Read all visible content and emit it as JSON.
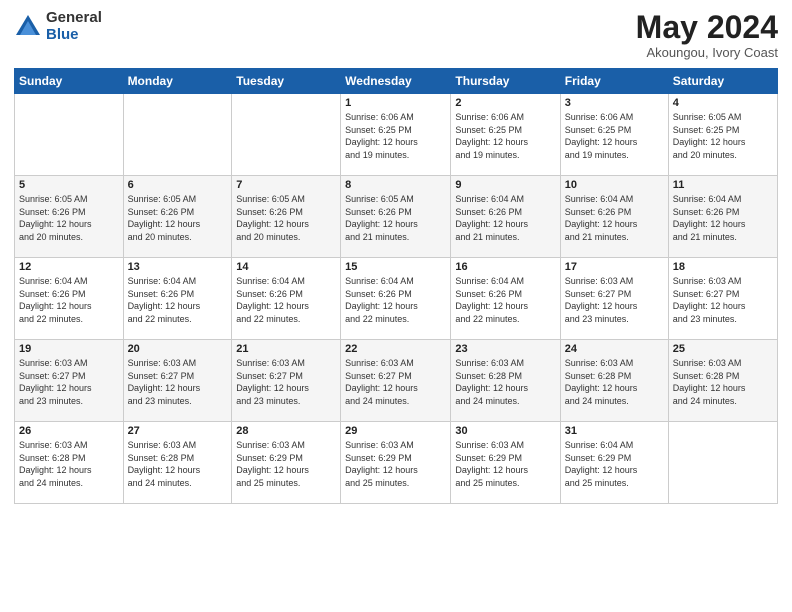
{
  "header": {
    "logo_general": "General",
    "logo_blue": "Blue",
    "month_title": "May 2024",
    "location": "Akoungou, Ivory Coast"
  },
  "days_of_week": [
    "Sunday",
    "Monday",
    "Tuesday",
    "Wednesday",
    "Thursday",
    "Friday",
    "Saturday"
  ],
  "weeks": [
    [
      {
        "day": "",
        "info": ""
      },
      {
        "day": "",
        "info": ""
      },
      {
        "day": "",
        "info": ""
      },
      {
        "day": "1",
        "info": "Sunrise: 6:06 AM\nSunset: 6:25 PM\nDaylight: 12 hours\nand 19 minutes."
      },
      {
        "day": "2",
        "info": "Sunrise: 6:06 AM\nSunset: 6:25 PM\nDaylight: 12 hours\nand 19 minutes."
      },
      {
        "day": "3",
        "info": "Sunrise: 6:06 AM\nSunset: 6:25 PM\nDaylight: 12 hours\nand 19 minutes."
      },
      {
        "day": "4",
        "info": "Sunrise: 6:05 AM\nSunset: 6:25 PM\nDaylight: 12 hours\nand 20 minutes."
      }
    ],
    [
      {
        "day": "5",
        "info": "Sunrise: 6:05 AM\nSunset: 6:26 PM\nDaylight: 12 hours\nand 20 minutes."
      },
      {
        "day": "6",
        "info": "Sunrise: 6:05 AM\nSunset: 6:26 PM\nDaylight: 12 hours\nand 20 minutes."
      },
      {
        "day": "7",
        "info": "Sunrise: 6:05 AM\nSunset: 6:26 PM\nDaylight: 12 hours\nand 20 minutes."
      },
      {
        "day": "8",
        "info": "Sunrise: 6:05 AM\nSunset: 6:26 PM\nDaylight: 12 hours\nand 21 minutes."
      },
      {
        "day": "9",
        "info": "Sunrise: 6:04 AM\nSunset: 6:26 PM\nDaylight: 12 hours\nand 21 minutes."
      },
      {
        "day": "10",
        "info": "Sunrise: 6:04 AM\nSunset: 6:26 PM\nDaylight: 12 hours\nand 21 minutes."
      },
      {
        "day": "11",
        "info": "Sunrise: 6:04 AM\nSunset: 6:26 PM\nDaylight: 12 hours\nand 21 minutes."
      }
    ],
    [
      {
        "day": "12",
        "info": "Sunrise: 6:04 AM\nSunset: 6:26 PM\nDaylight: 12 hours\nand 22 minutes."
      },
      {
        "day": "13",
        "info": "Sunrise: 6:04 AM\nSunset: 6:26 PM\nDaylight: 12 hours\nand 22 minutes."
      },
      {
        "day": "14",
        "info": "Sunrise: 6:04 AM\nSunset: 6:26 PM\nDaylight: 12 hours\nand 22 minutes."
      },
      {
        "day": "15",
        "info": "Sunrise: 6:04 AM\nSunset: 6:26 PM\nDaylight: 12 hours\nand 22 minutes."
      },
      {
        "day": "16",
        "info": "Sunrise: 6:04 AM\nSunset: 6:26 PM\nDaylight: 12 hours\nand 22 minutes."
      },
      {
        "day": "17",
        "info": "Sunrise: 6:03 AM\nSunset: 6:27 PM\nDaylight: 12 hours\nand 23 minutes."
      },
      {
        "day": "18",
        "info": "Sunrise: 6:03 AM\nSunset: 6:27 PM\nDaylight: 12 hours\nand 23 minutes."
      }
    ],
    [
      {
        "day": "19",
        "info": "Sunrise: 6:03 AM\nSunset: 6:27 PM\nDaylight: 12 hours\nand 23 minutes."
      },
      {
        "day": "20",
        "info": "Sunrise: 6:03 AM\nSunset: 6:27 PM\nDaylight: 12 hours\nand 23 minutes."
      },
      {
        "day": "21",
        "info": "Sunrise: 6:03 AM\nSunset: 6:27 PM\nDaylight: 12 hours\nand 23 minutes."
      },
      {
        "day": "22",
        "info": "Sunrise: 6:03 AM\nSunset: 6:27 PM\nDaylight: 12 hours\nand 24 minutes."
      },
      {
        "day": "23",
        "info": "Sunrise: 6:03 AM\nSunset: 6:28 PM\nDaylight: 12 hours\nand 24 minutes."
      },
      {
        "day": "24",
        "info": "Sunrise: 6:03 AM\nSunset: 6:28 PM\nDaylight: 12 hours\nand 24 minutes."
      },
      {
        "day": "25",
        "info": "Sunrise: 6:03 AM\nSunset: 6:28 PM\nDaylight: 12 hours\nand 24 minutes."
      }
    ],
    [
      {
        "day": "26",
        "info": "Sunrise: 6:03 AM\nSunset: 6:28 PM\nDaylight: 12 hours\nand 24 minutes."
      },
      {
        "day": "27",
        "info": "Sunrise: 6:03 AM\nSunset: 6:28 PM\nDaylight: 12 hours\nand 24 minutes."
      },
      {
        "day": "28",
        "info": "Sunrise: 6:03 AM\nSunset: 6:29 PM\nDaylight: 12 hours\nand 25 minutes."
      },
      {
        "day": "29",
        "info": "Sunrise: 6:03 AM\nSunset: 6:29 PM\nDaylight: 12 hours\nand 25 minutes."
      },
      {
        "day": "30",
        "info": "Sunrise: 6:03 AM\nSunset: 6:29 PM\nDaylight: 12 hours\nand 25 minutes."
      },
      {
        "day": "31",
        "info": "Sunrise: 6:04 AM\nSunset: 6:29 PM\nDaylight: 12 hours\nand 25 minutes."
      },
      {
        "day": "",
        "info": ""
      }
    ]
  ]
}
